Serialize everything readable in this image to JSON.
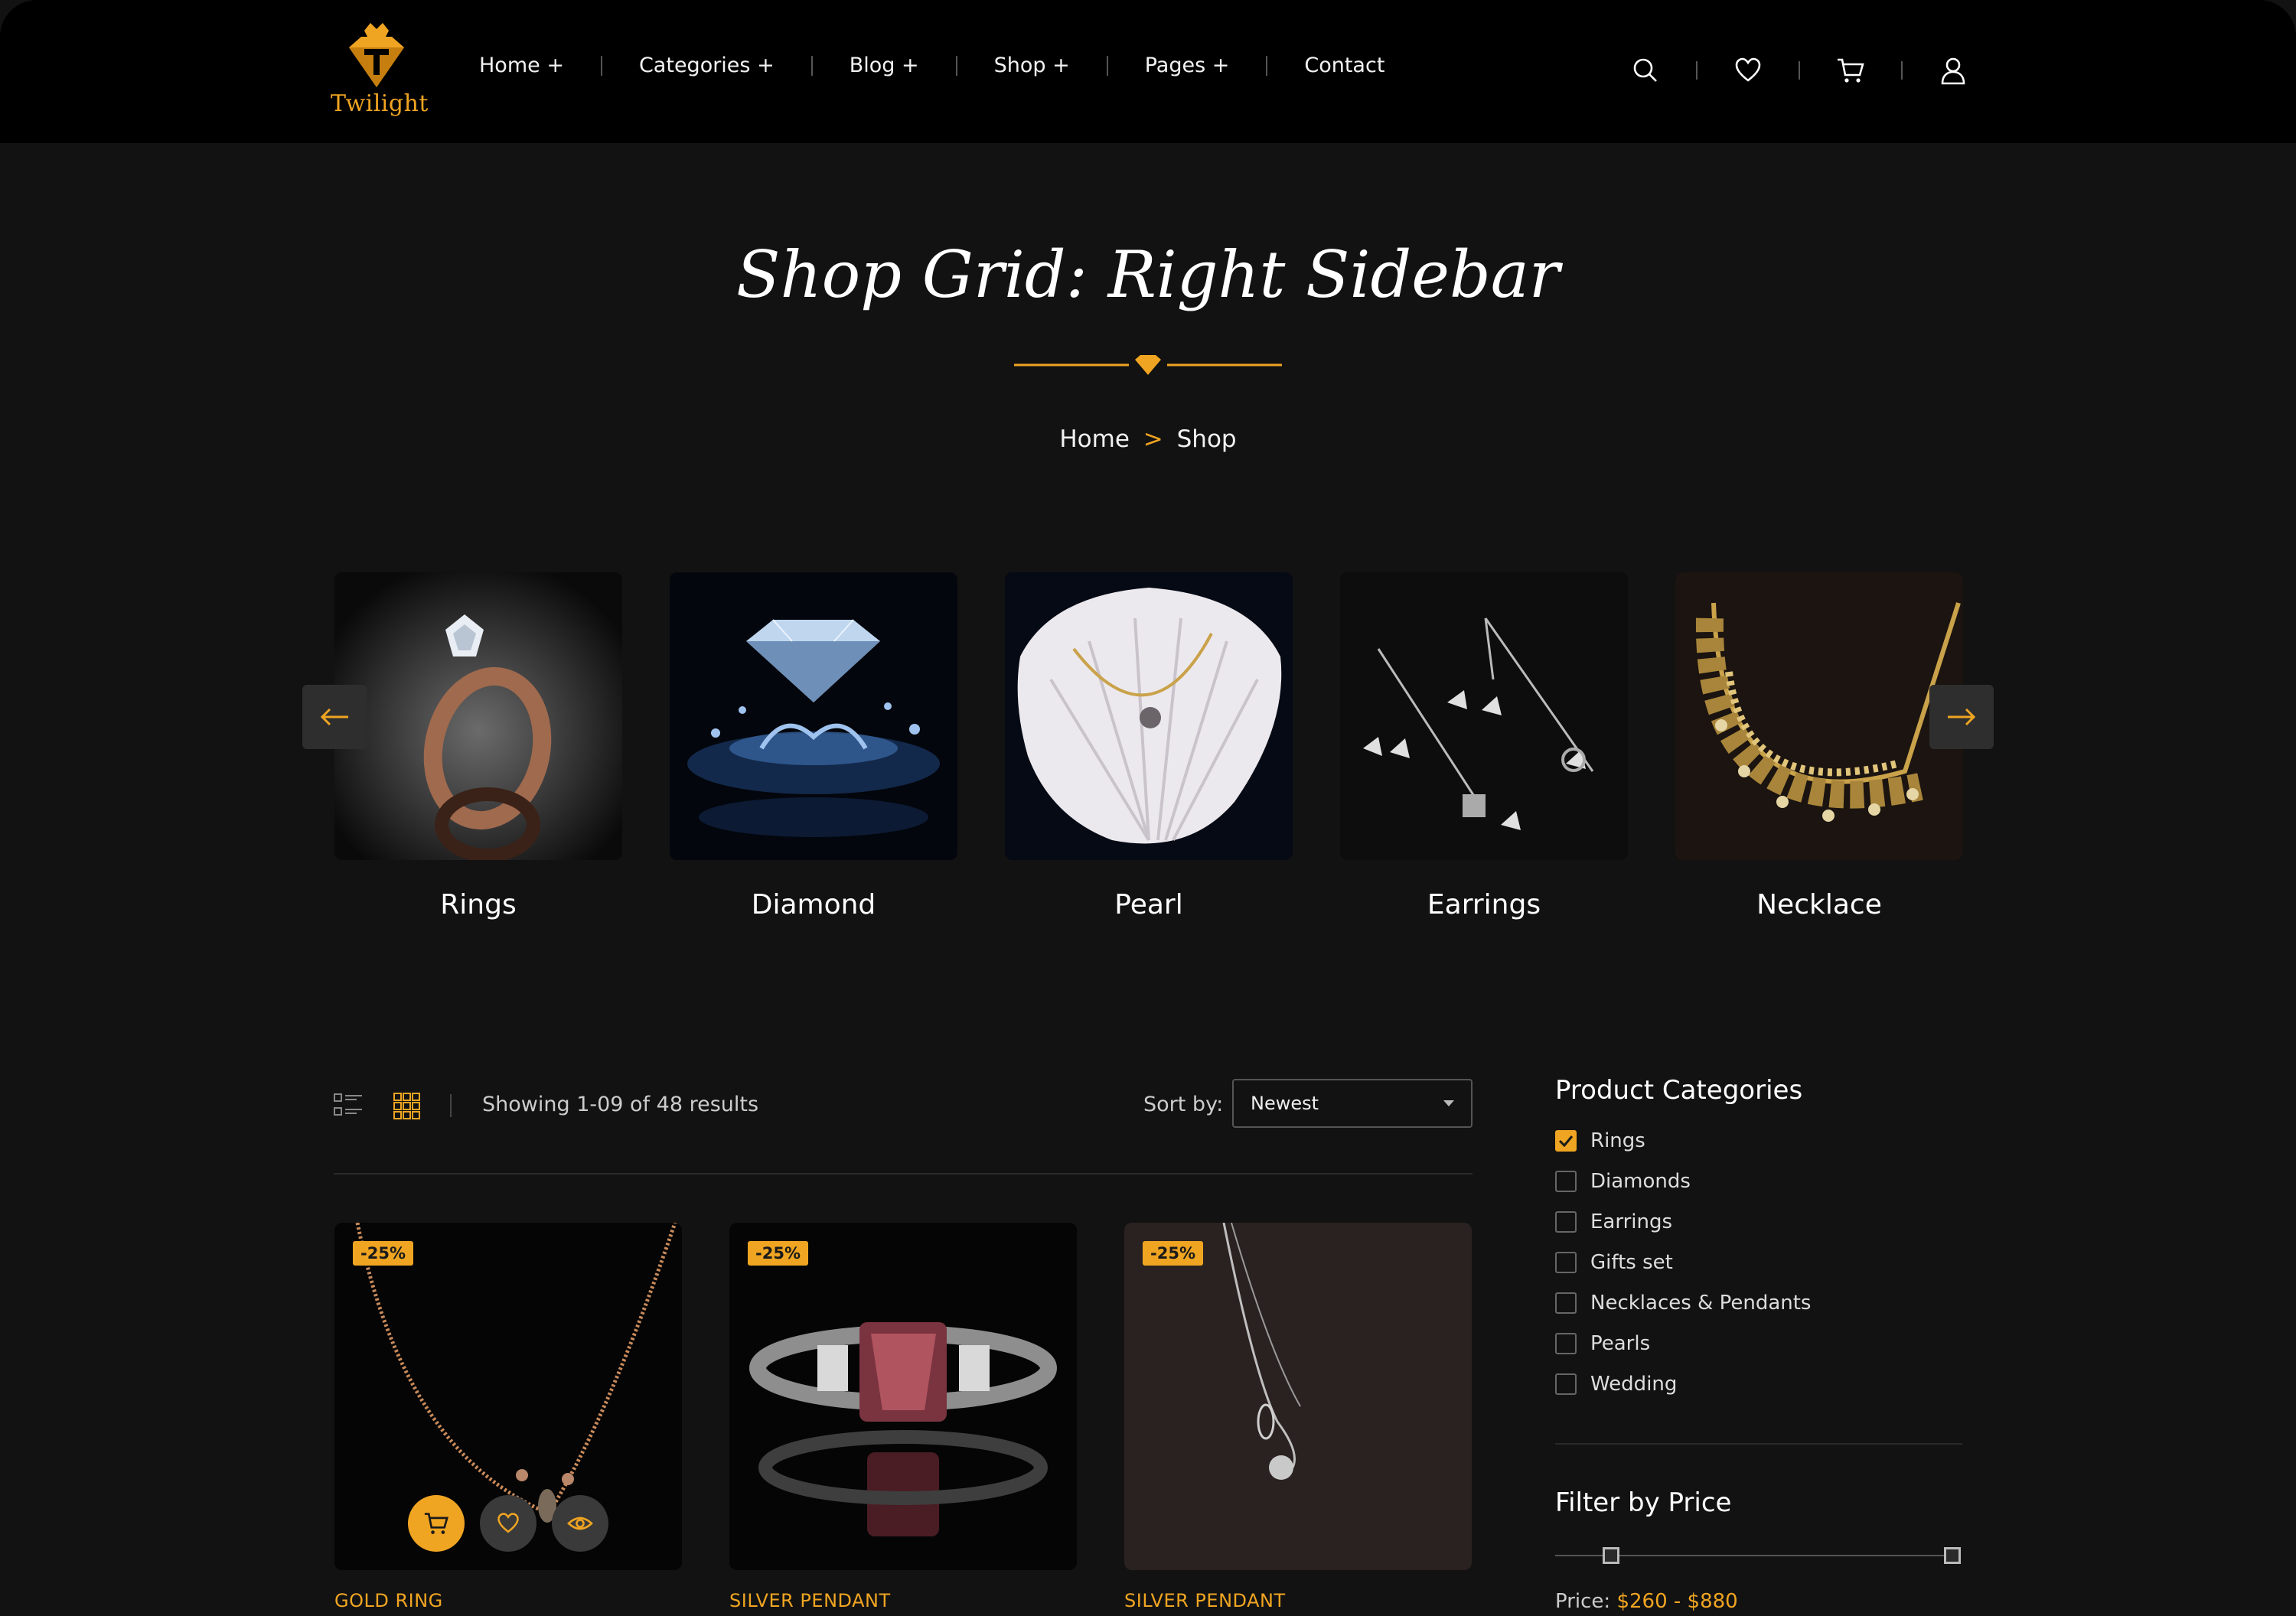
{
  "brand": {
    "name": "Twilight",
    "accent": "#f0a522"
  },
  "nav": [
    {
      "label": "Home +"
    },
    {
      "label": "Categories +"
    },
    {
      "label": "Blog +"
    },
    {
      "label": "Shop +"
    },
    {
      "label": "Pages +"
    },
    {
      "label": "Contact"
    }
  ],
  "tools": [
    "search-icon",
    "heart-icon",
    "cart-icon",
    "user-icon"
  ],
  "hero": {
    "title": "Shop Grid: Right Sidebar",
    "breadcrumb": {
      "home": "Home",
      "sep": ">",
      "current": "Shop"
    }
  },
  "categories": [
    {
      "label": "Rings"
    },
    {
      "label": "Diamond"
    },
    {
      "label": "Pearl"
    },
    {
      "label": "Earrings"
    },
    {
      "label": "Necklace"
    }
  ],
  "toolbar": {
    "results": "Showing 1-09 of 48 results",
    "sort_label": "Sort by:",
    "sort_value": "Newest"
  },
  "products": [
    {
      "name": "GOLD RING",
      "badge": "-25%"
    },
    {
      "name": "SILVER PENDANT",
      "badge": "-25%"
    },
    {
      "name": "SILVER PENDANT",
      "badge": "-25%"
    }
  ],
  "sidebar": {
    "categories_title": "Product Categories",
    "categories": [
      {
        "label": "Rings",
        "checked": true
      },
      {
        "label": "Diamonds",
        "checked": false
      },
      {
        "label": "Earrings",
        "checked": false
      },
      {
        "label": "Gifts set",
        "checked": false
      },
      {
        "label": "Necklaces & Pendants",
        "checked": false
      },
      {
        "label": "Pearls",
        "checked": false
      },
      {
        "label": "Wedding",
        "checked": false
      }
    ],
    "price_title": "Filter by Price",
    "price_label": "Price:",
    "price_value": "$260 - $880"
  }
}
